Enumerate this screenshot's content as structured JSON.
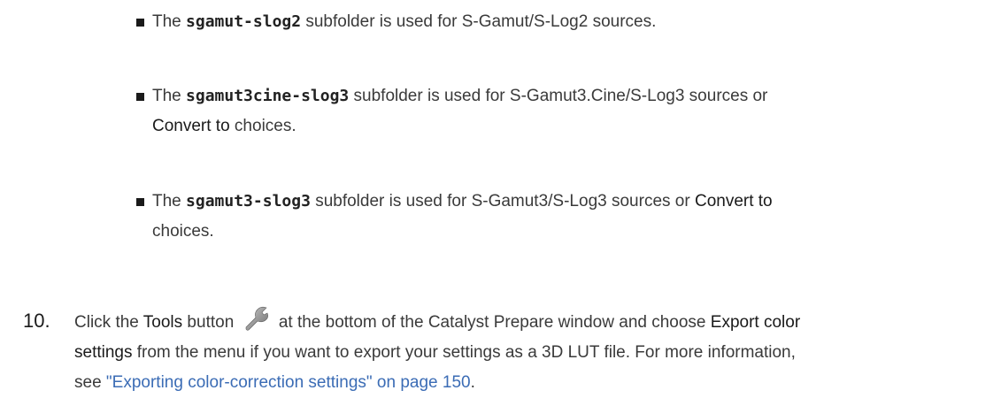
{
  "bullets": [
    {
      "prefix": "The ",
      "folder": "sgamut-slog2",
      "line1_suffix": " subfolder is used for S-Gamut/S-Log2 sources.",
      "line2_pre": "",
      "bold": "",
      "line2_post": ""
    },
    {
      "prefix": "The ",
      "folder": "sgamut3cine-slog3",
      "line1_suffix": " subfolder is used for S-Gamut3.Cine/S-Log3 sources or",
      "line2_pre": "",
      "bold": "Convert to",
      "line2_post": " choices."
    },
    {
      "prefix": "The ",
      "folder": "sgamut3-slog3",
      "line1_suffix": " subfolder is used for S-Gamut3/S-Log3 sources or ",
      "line1_bold": "Convert to",
      "line2_post": "choices."
    }
  ],
  "step": {
    "number": "10.",
    "part1": "Click the ",
    "tools": "Tools",
    "part2": " button ",
    "part3": " at the bottom of the Catalyst Prepare window and choose ",
    "export": "Export color",
    "settings": "settings",
    "part4": " from the menu if you want to export your settings as a 3D LUT file. For more information,",
    "part5": "see ",
    "link": "\"Exporting color-correction settings\" on page 150",
    "part6": ".",
    "tools_icon": "wrench-icon",
    "link_color": "#3b6cb5"
  }
}
